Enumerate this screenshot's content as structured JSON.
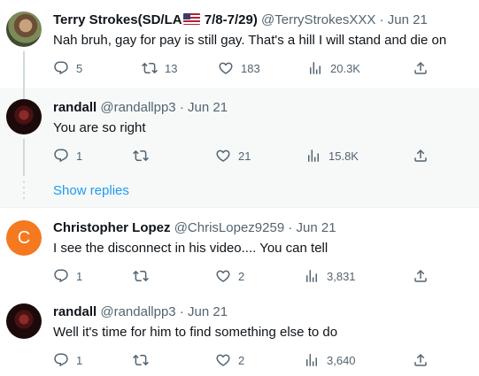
{
  "tweets": [
    {
      "name": "Terry Strokes(SD/LA",
      "name_suffix": " 7/8-7/29)",
      "handle": "@TerryStrokesXXX",
      "dot": "·",
      "date": "Jun 21",
      "text": "Nah bruh, gay for pay is still gay. That's a hill I will stand and die on",
      "replies": "5",
      "retweets": "13",
      "likes": "183",
      "views": "20.3K"
    },
    {
      "name": "randall",
      "handle": "@randallpp3",
      "dot": "·",
      "date": "Jun 21",
      "text": "You are so right",
      "replies": "1",
      "retweets": "",
      "likes": "21",
      "views": "15.8K"
    },
    {
      "avatar_letter": "C",
      "name": "Christopher Lopez",
      "handle": "@ChrisLopez9259",
      "dot": "·",
      "date": "Jun 21",
      "text": "I see the disconnect in his video.... You can tell",
      "replies": "1",
      "retweets": "",
      "likes": "2",
      "views": "3,831"
    },
    {
      "name": "randall",
      "handle": "@randallpp3",
      "dot": "·",
      "date": "Jun 21",
      "text": "Well it's time for him to find something else to do",
      "replies": "1",
      "retweets": "",
      "likes": "2",
      "views": "3,640"
    }
  ],
  "show_replies": "Show replies",
  "colors": {
    "link": "#1d9bf0",
    "muted": "#536471",
    "avatar_orange": "#f4791f",
    "thread_bg": "#f7f9f9"
  },
  "icons": [
    "reply-icon",
    "retweet-icon",
    "like-icon",
    "views-icon",
    "share-icon",
    "us-flag-icon"
  ]
}
